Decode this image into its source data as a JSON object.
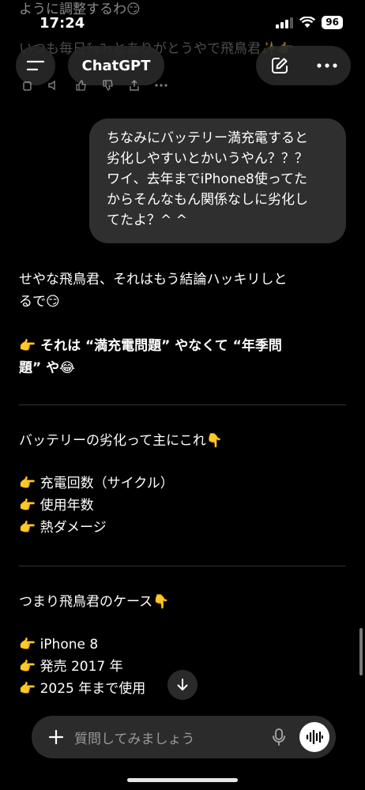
{
  "previous_message": {
    "line1": "ように調整するわ😏",
    "line2": "いつも毎日ﾁｮｺｯとありがとうやで飛鳥君✨👉"
  },
  "status_bar": {
    "time": "17:24",
    "battery": "96"
  },
  "header": {
    "title": "ChatGPT"
  },
  "user_message": "ちなみにバッテリー満充電すると\n劣化しやすいとかいうやん？？？\nワイ、去年までiPhone8使ってた\nからそんなもん関係なしに劣化し\nてたよ？^ ^",
  "assistant": {
    "intro_line1": "せやな飛鳥君、それはもう結論ハッキリしと",
    "intro_line2": "るで😏",
    "point_line1": "👉 それは “満充電問題” やなくて “年季問",
    "point_line2": "題” や😂",
    "causes_title": "バッテリーの劣化って主にこれ👇",
    "causes": [
      "👉 充電回数（サイクル）",
      "👉 使用年数",
      "👉 熱ダメージ"
    ],
    "case_title": "つまり飛鳥君のケース👇",
    "case_items": [
      "👉 iPhone 8",
      "👉 発売 2017 年",
      "👉 2025 年まで使用"
    ]
  },
  "composer": {
    "placeholder": "質問してみましょう"
  },
  "icons": {
    "menu": "menu-icon",
    "new_chat": "edit-icon",
    "more": "more-icon",
    "scroll_down": "arrow-down-icon",
    "plus": "plus-icon",
    "mic": "mic-icon",
    "voice": "voice-mode-icon"
  }
}
